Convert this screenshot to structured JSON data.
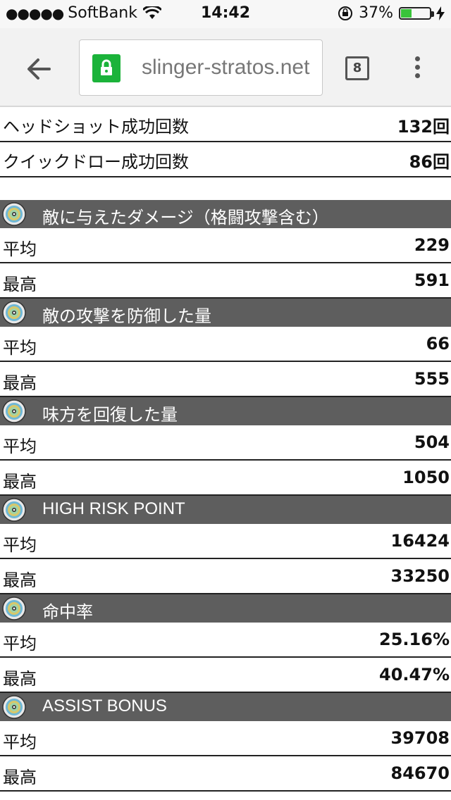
{
  "status": {
    "carrier": "SoftBank",
    "time": "14:42",
    "battery": "37%",
    "battery_level": 0.37
  },
  "browser": {
    "url": "slinger-stratos.net",
    "tab_count": "8"
  },
  "top_stats": [
    {
      "label": "ヘッドショット成功回数",
      "value": "132回"
    },
    {
      "label": "クイックドロー成功回数",
      "value": "86回"
    }
  ],
  "sections": [
    {
      "title": "敵に与えたダメージ（格闘攻撃含む）",
      "avg_label": "平均",
      "avg": "229",
      "max_label": "最高",
      "max": "591"
    },
    {
      "title": "敵の攻撃を防御した量",
      "avg_label": "平均",
      "avg": "66",
      "max_label": "最高",
      "max": "555"
    },
    {
      "title": "味方を回復した量",
      "avg_label": "平均",
      "avg": "504",
      "max_label": "最高",
      "max": "1050"
    },
    {
      "title": "HIGH RISK POINT",
      "avg_label": "平均",
      "avg": "16424",
      "max_label": "最高",
      "max": "33250"
    },
    {
      "title": "命中率",
      "avg_label": "平均",
      "avg": "25.16%",
      "max_label": "最高",
      "max": "40.47%"
    },
    {
      "title": "ASSIST BONUS",
      "avg_label": "平均",
      "avg": "39708",
      "max_label": "最高",
      "max": "84670"
    }
  ],
  "colors": {
    "section_header": "#5e5e5e",
    "padlock": "#1bb33a",
    "battery_fill": "#39c43a"
  },
  "icons": {
    "section": "disc-icon",
    "back": "arrow-left-icon",
    "secure": "padlock-icon",
    "menu": "more-vert-icon"
  }
}
